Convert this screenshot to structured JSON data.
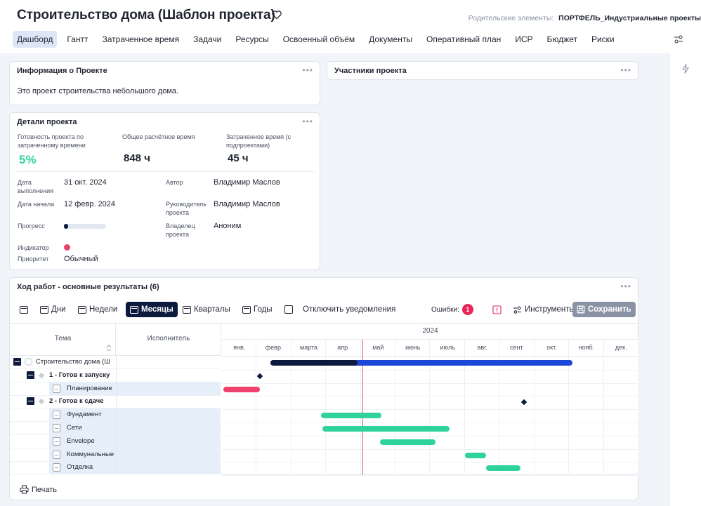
{
  "header": {
    "title": "Строительство дома (Шаблон проекта)",
    "parent_label": "Родительские элементы:",
    "parent_value": "ПОРТФЕЛЬ_Индустриальные проекты"
  },
  "tabs": [
    "Дашборд",
    "Гантт",
    "Затраченное время",
    "Задачи",
    "Ресурсы",
    "Освоенный объём",
    "Документы",
    "Оперативный план",
    "ИСР",
    "Бюджет",
    "Риски"
  ],
  "info_card": {
    "title": "Информация о Проекте",
    "text": "Это проект строительства небольшого дома."
  },
  "participants_card": {
    "title": "Участники проекта"
  },
  "details": {
    "title": "Детали проекта",
    "readiness_label": "Готовность проекта по затраченному времени",
    "readiness_value": "5%",
    "estimate_label": "Общее расчётное время",
    "estimate_value": "848 ч",
    "spent_label": "Затраченное время (с подпроектами)",
    "spent_value": "45 ч",
    "due_label": "Дата выполнения",
    "due_value": "31 окт. 2024",
    "start_label": "Дата начала",
    "start_value": "12 февр. 2024",
    "progress_label": "Прогресс",
    "progress_fraction": 0.05,
    "indicator_label": "Индикатор",
    "indicator_color": "#e8426b",
    "priority_label": "Приоритет",
    "priority_value": "Обычный",
    "author_label": "Автор",
    "author_value": "Владимир Маслов",
    "manager_label": "Руководитель проекта",
    "manager_value": "Владимир Маслов",
    "owner_label": "Владелец проекта",
    "owner_value": "Аноним"
  },
  "gantt": {
    "title": "Ход работ - основные результаты (6)",
    "toolbar": {
      "days": "Дни",
      "weeks": "Недели",
      "months": "Месяцы",
      "quarters": "Кварталы",
      "years": "Годы",
      "disable_notifications": "Отключить уведомления",
      "errors_label": "Ошибки:",
      "errors_count": "1",
      "tools": "Инструменты",
      "save": "Сохранить"
    },
    "columns": {
      "topic": "Тема",
      "assignee": "Исполнитель"
    },
    "year": "2024",
    "months": [
      "янв.",
      "февр.",
      "марта",
      "апр.",
      "май",
      "июнь",
      "июль",
      "авг.",
      "сент.",
      "окт.",
      "нояб.",
      "дек."
    ],
    "rows": [
      {
        "label": "Строительство дома (Ш",
        "level": 0,
        "kind": "project"
      },
      {
        "label": "1 - Готов к запуску",
        "level": 1,
        "kind": "milestone-group"
      },
      {
        "label": "Планирование",
        "level": 2,
        "kind": "task"
      },
      {
        "label": "2 - Готов к сдаче",
        "level": 1,
        "kind": "milestone-group"
      },
      {
        "label": "Фундамент",
        "level": 2,
        "kind": "task"
      },
      {
        "label": "Сети",
        "level": 2,
        "kind": "task"
      },
      {
        "label": "Envelope",
        "level": 2,
        "kind": "task"
      },
      {
        "label": "Коммунальные",
        "level": 2,
        "kind": "task"
      },
      {
        "label": "Отделка",
        "level": 2,
        "kind": "task"
      }
    ],
    "bars": [
      {
        "row": 0,
        "start_month": 1.4,
        "end_month": 10.1,
        "color": "#1a47d6"
      },
      {
        "row": 0,
        "start_month": 1.4,
        "end_month": 3.9,
        "color": "#0c1a3d"
      },
      {
        "row": 2,
        "start_month": 0.05,
        "end_month": 1.1,
        "color": "#f0426e"
      },
      {
        "row": 4,
        "start_month": 2.85,
        "end_month": 4.6,
        "color": "#2fd39a"
      },
      {
        "row": 5,
        "start_month": 2.9,
        "end_month": 6.55,
        "color": "#2fd39a"
      },
      {
        "row": 6,
        "start_month": 4.55,
        "end_month": 6.15,
        "color": "#2fd39a"
      },
      {
        "row": 7,
        "start_month": 7.0,
        "end_month": 7.6,
        "color": "#2fd39a"
      },
      {
        "row": 8,
        "start_month": 7.6,
        "end_month": 8.6,
        "color": "#2fd39a"
      }
    ],
    "milestones": [
      {
        "row": 1,
        "month": 1.1
      },
      {
        "row": 3,
        "month": 8.7
      }
    ],
    "today_month": 4.05,
    "print": "Печать"
  }
}
